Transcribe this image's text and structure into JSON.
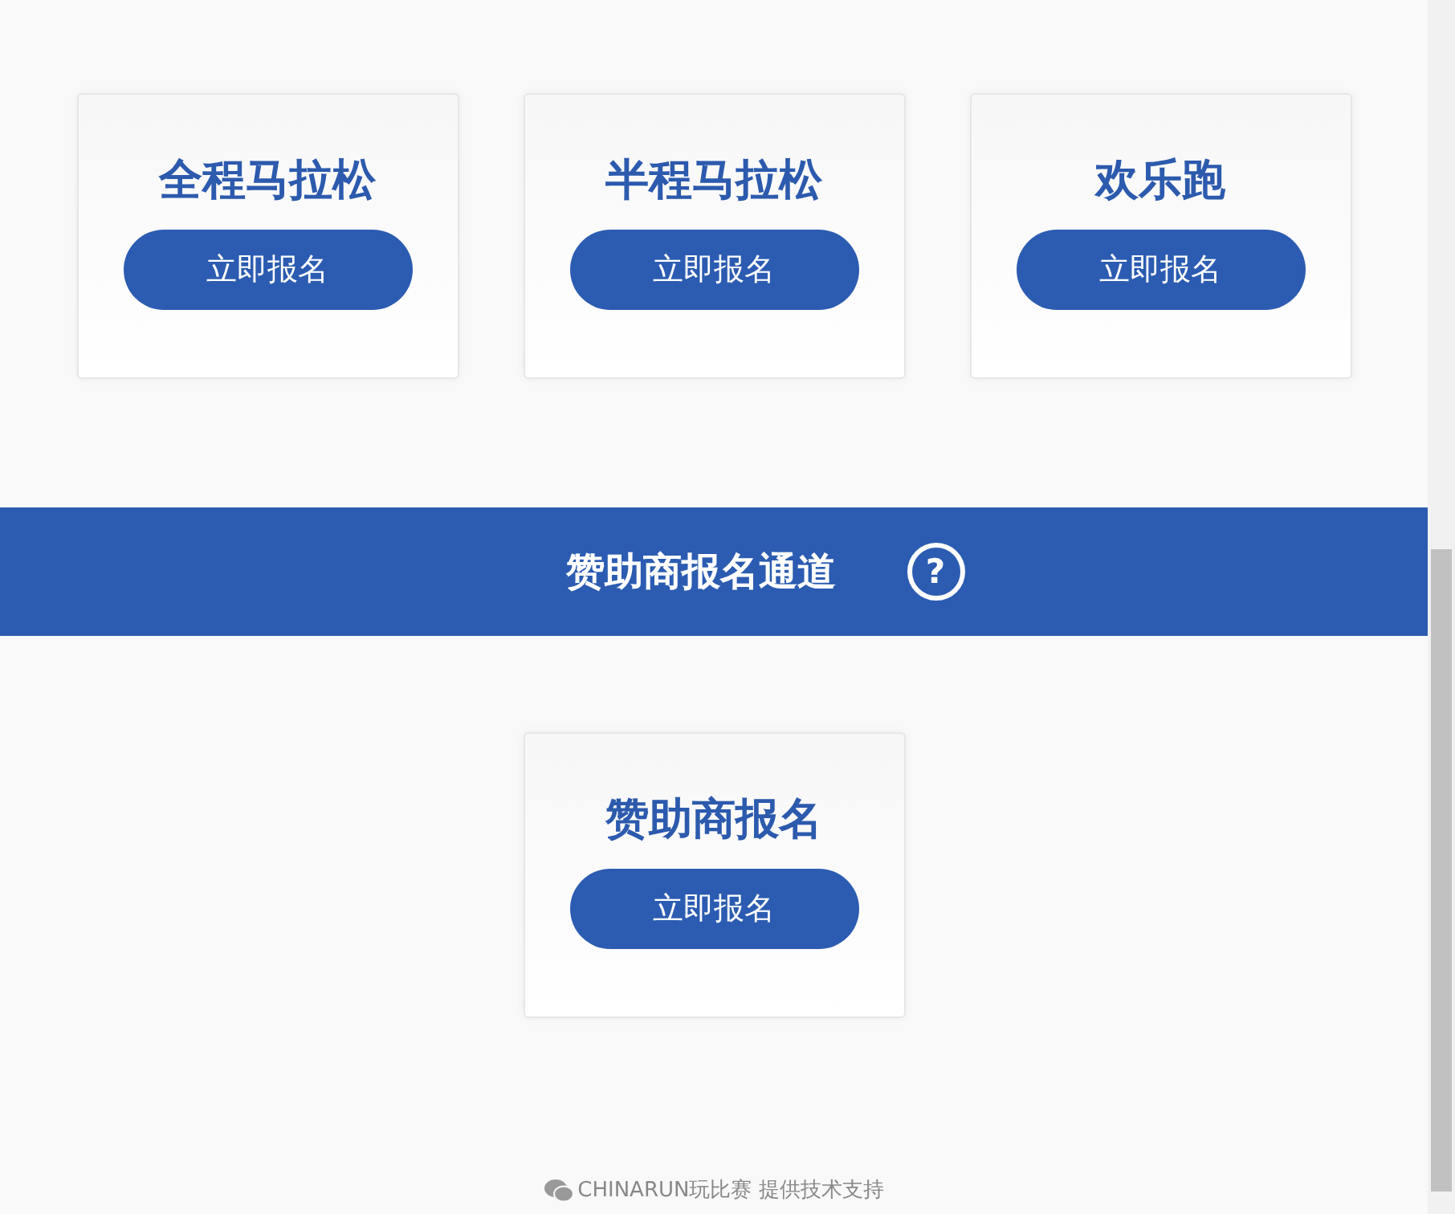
{
  "race_cards": [
    {
      "title": "全程马拉松",
      "button": "立即报名"
    },
    {
      "title": "半程马拉松",
      "button": "立即报名"
    },
    {
      "title": "欢乐跑",
      "button": "立即报名"
    }
  ],
  "sponsor_banner": {
    "title": "赞助商报名通道",
    "help_icon": "?"
  },
  "sponsor_cards": [
    {
      "title": "赞助商报名",
      "button": "立即报名"
    }
  ],
  "footer": {
    "text": "CHINARUN玩比赛 提供技术支持"
  }
}
